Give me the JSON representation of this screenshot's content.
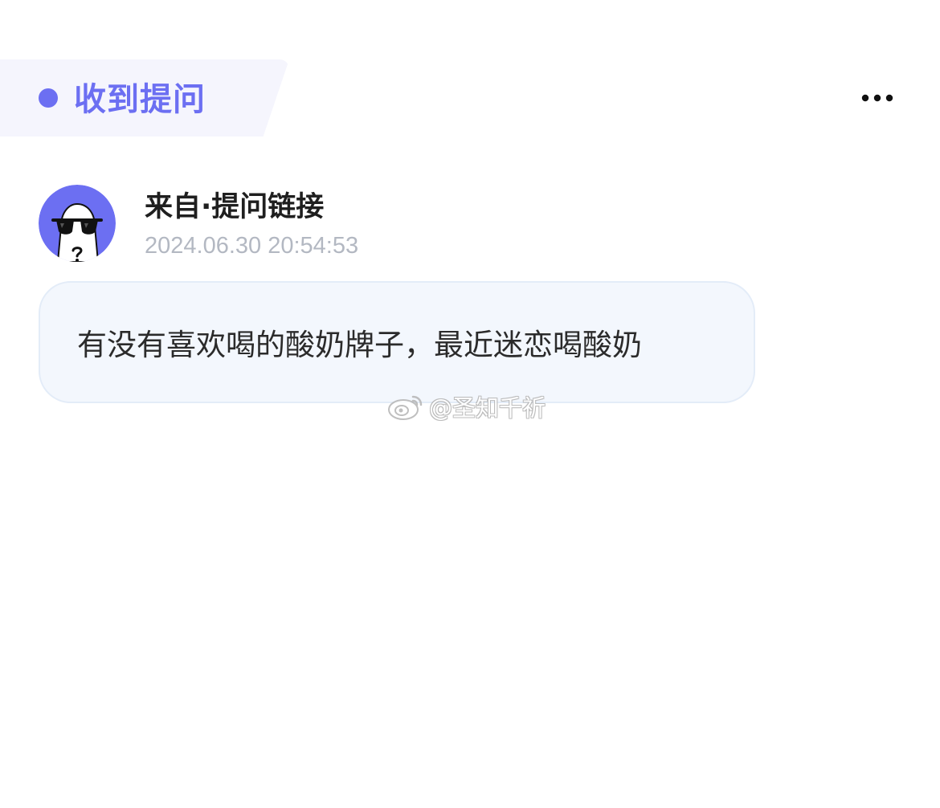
{
  "header": {
    "title": "收到提问",
    "accent_color": "#6c6ff2",
    "more_icon": "more-horizontal-icon"
  },
  "message": {
    "avatar_icon": "anonymous-sunglasses-avatar",
    "avatar_color": "#6c6ff2",
    "sender": "来自·提问链接",
    "timestamp": "2024.06.30 20:54:53",
    "content": "有没有喜欢喝的酸奶牌子，最近迷恋喝酸奶"
  },
  "watermark": {
    "icon": "weibo-logo-icon",
    "text": "@圣知千祈"
  }
}
